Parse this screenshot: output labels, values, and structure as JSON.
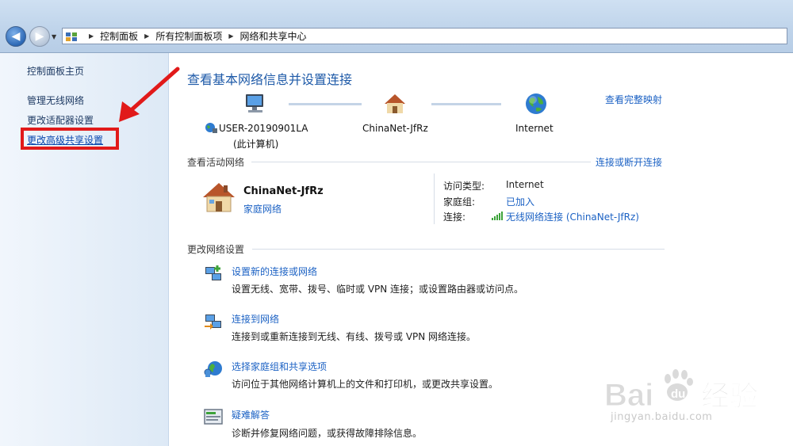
{
  "breadcrumb": [
    "控制面板",
    "所有控制面板项",
    "网络和共享中心"
  ],
  "sidebar": {
    "home": "控制面板主页",
    "items": [
      "管理无线网络",
      "更改适配器设置",
      "更改高级共享设置"
    ]
  },
  "main": {
    "title": "查看基本网络信息并设置连接",
    "view_full_map": "查看完整映射",
    "map": {
      "computer_name": "USER-20190901LA",
      "computer_sub": "(此计算机)",
      "network": "ChinaNet-JfRz",
      "internet": "Internet"
    },
    "active_section": {
      "title": "查看活动网络",
      "connect_link": "连接或断开连接",
      "network_name": "ChinaNet-JfRz",
      "network_type": "家庭网络",
      "props": [
        {
          "label": "访问类型:",
          "value": "Internet",
          "link": false
        },
        {
          "label": "家庭组:",
          "value": "已加入",
          "link": true
        },
        {
          "label": "连接:",
          "value": "无线网络连接 (ChinaNet-JfRz)",
          "link": true
        }
      ]
    },
    "change_section": {
      "title": "更改网络设置",
      "tasks": [
        {
          "link": "设置新的连接或网络",
          "desc": "设置无线、宽带、拨号、临时或 VPN 连接；或设置路由器或访问点。",
          "icon": "new-connection-icon"
        },
        {
          "link": "连接到网络",
          "desc": "连接到或重新连接到无线、有线、拨号或 VPN 网络连接。",
          "icon": "connect-network-icon"
        },
        {
          "link": "选择家庭组和共享选项",
          "desc": "访问位于其他网络计算机上的文件和打印机，或更改共享设置。",
          "icon": "homegroup-icon"
        },
        {
          "link": "疑难解答",
          "desc": "诊断并修复网络问题，或获得故障排除信息。",
          "icon": "troubleshoot-icon"
        }
      ]
    }
  },
  "watermark": {
    "brand_latin": "Bai",
    "brand_latin2": "du",
    "brand_cn": "经验",
    "url": "jingyan.baidu.com"
  },
  "colors": {
    "link": "#1c62c4",
    "title": "#1e5aa8",
    "highlight_box": "#e11a1a"
  }
}
